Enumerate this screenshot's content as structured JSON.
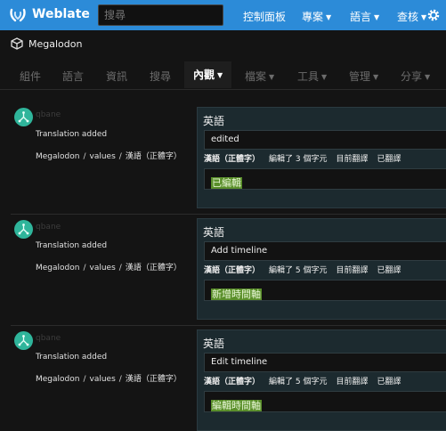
{
  "header": {
    "brand": "Weblate",
    "search_placeholder": "搜尋",
    "nav": [
      {
        "label": "控制面板",
        "caret": false
      },
      {
        "label": "專案",
        "caret": true
      },
      {
        "label": "語言",
        "caret": true
      },
      {
        "label": "查核",
        "caret": true
      }
    ]
  },
  "breadcrumb": {
    "project": "Megalodon"
  },
  "tabs": [
    {
      "label": "組件"
    },
    {
      "label": "語言"
    },
    {
      "label": "資訊"
    },
    {
      "label": "搜尋"
    },
    {
      "label": "內觀",
      "active": true
    },
    {
      "label": "檔案",
      "caret": true
    },
    {
      "label": "工具",
      "caret": true
    },
    {
      "label": "管理",
      "caret": true
    },
    {
      "label": "分享",
      "caret": true
    }
  ],
  "entries": [
    {
      "user": "qbane",
      "action": "Translation added",
      "path": [
        "Megalodon",
        "values",
        "漢語（正體字）"
      ],
      "source_lang": "英語",
      "source": "edited",
      "target_lang": "漢語（正體字）",
      "edit_info": "編輯了 3 個字元",
      "current": "目前翻譯",
      "translated": "已翻譯",
      "target": "已編輯"
    },
    {
      "user": "qbane",
      "action": "Translation added",
      "path": [
        "Megalodon",
        "values",
        "漢語（正體字）"
      ],
      "source_lang": "英語",
      "source": "Add timeline",
      "target_lang": "漢語（正體字）",
      "edit_info": "編輯了 5 個字元",
      "current": "目前翻譯",
      "translated": "已翻譯",
      "target": "新增時間軸"
    },
    {
      "user": "qbane",
      "action": "Translation added",
      "path": [
        "Megalodon",
        "values",
        "漢語（正體字）"
      ],
      "source_lang": "英語",
      "source": "Edit timeline",
      "target_lang": "漢語（正體字）",
      "edit_info": "編輯了 5 個字元",
      "current": "目前翻譯",
      "translated": "已翻譯",
      "target": "編輯時間軸"
    }
  ]
}
